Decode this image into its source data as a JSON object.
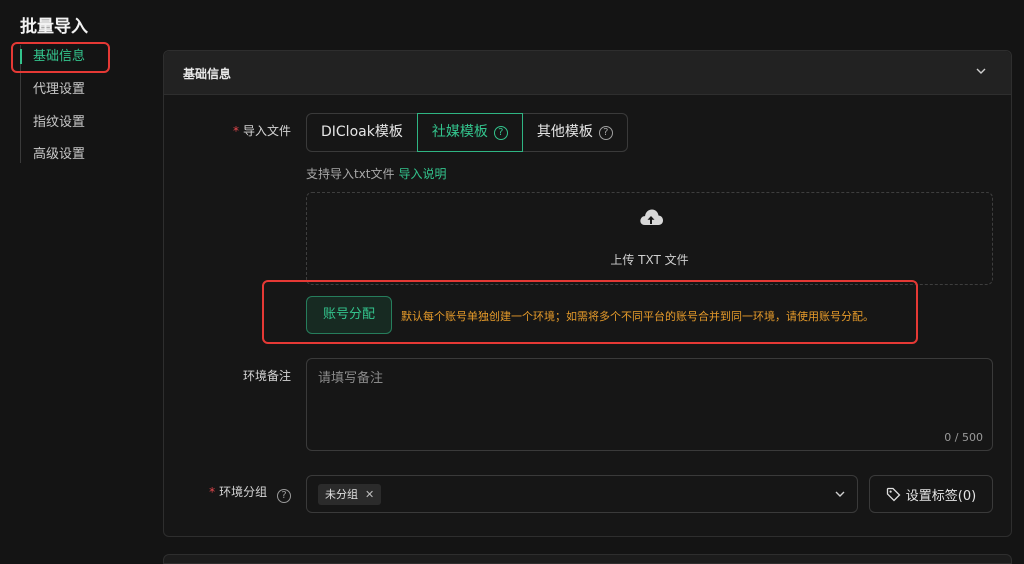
{
  "page": {
    "title": "批量导入"
  },
  "sidebar": {
    "items": [
      {
        "label": "基础信息",
        "active": true
      },
      {
        "label": "代理设置"
      },
      {
        "label": "指纹设置"
      },
      {
        "label": "高级设置"
      }
    ]
  },
  "panel": {
    "title": "基础信息",
    "import_file": {
      "label": "导入文件",
      "templates": [
        {
          "label": "DICloak模板"
        },
        {
          "label": "社媒模板",
          "active": true
        },
        {
          "label": "其他模板"
        }
      ],
      "hint": "支持导入txt文件",
      "hint_link": "导入说明",
      "dropzone_text": "上传 TXT 文件"
    },
    "account_allocation": {
      "button_label": "账号分配",
      "note": "默认每个账号单独创建一个环境；如需将多个不同平台的账号合并到同一环境，请使用账号分配。"
    },
    "remark": {
      "label": "环境备注",
      "placeholder": "请填写备注",
      "counter": "0 / 500"
    },
    "group": {
      "label": "环境分组",
      "selected_tag": "未分组",
      "set_tags_label": "设置标签(0)"
    }
  },
  "colors": {
    "accent": "#33c48d",
    "warning_text": "#e69b2a",
    "highlight_box": "#e53935",
    "required": "#e5484d"
  },
  "icons": {
    "collapse": "chevron-up-icon",
    "help": "question-circle-icon",
    "upload": "cloud-upload-icon",
    "tag_close": "close-icon",
    "select": "chevron-down-icon",
    "set_tags": "tag-icon"
  }
}
